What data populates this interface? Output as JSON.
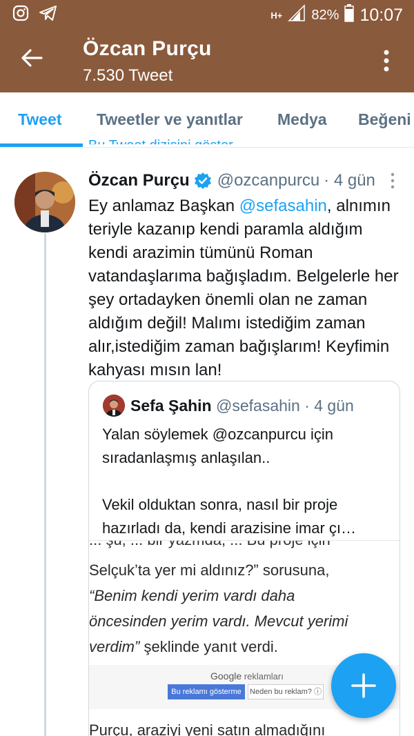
{
  "status_bar": {
    "network": "H+",
    "battery": "82%",
    "time": "10:07",
    "left_icons": [
      "instagram-icon",
      "telegram-icon"
    ]
  },
  "header": {
    "title": "Özcan Purçu",
    "subtitle": "7.530 Tweet"
  },
  "tabs": [
    {
      "label": "Tweet",
      "active": true
    },
    {
      "label": "Tweetler ve yanıtlar",
      "active": false
    },
    {
      "label": "Medya",
      "active": false
    },
    {
      "label": "Beğeni",
      "active": false
    }
  ],
  "hidden_text": "Bu Tweet dizisini göster",
  "tweet": {
    "author_name": "Özcan Purçu",
    "handle": "@ozcanpurcu",
    "time": "· 4 gün",
    "text_before_mention": "Ey anlamaz Başkan ",
    "mention": "@sefasahin",
    "text_after_mention": ", alnımın teriyle kazanıp kendi paramla aldığım kendi arazimin tümünü Roman vatandaşlarıma bağışladım. Belgelerle her şey ortadayken önemli olan ne zaman aldığım değil! Malımı istediğim zaman alır,istediğim zaman bağışlarım! Keyfimin kahyası mısın lan!"
  },
  "quoted": {
    "author_name": "Sefa Şahin",
    "handle": "@sefasahin",
    "time": "· 4 gün",
    "line1": "Yalan söylemek @ozcanpurcu için",
    "line2": "sıradanlaşmış anlaşılan..",
    "line3": "Vekil olduktan sonra, nasıl bir proje",
    "line4": "hazırladı da, kendi arazisine imar çı…",
    "image": {
      "cut_text": "... şu, ... bir yazmda, ... Bu proje için",
      "line1": "Selçuk’ta yer mi aldınız?” sorusuna,",
      "line2": "“Benim kendi yerim vardı daha",
      "line3": "öncesinden yerim vardı. Mevcut yerimi",
      "line4_italic": "verdim”",
      "line4_rest": " şeklinde yanıt verdi.",
      "ad_brand": "Google",
      "ad_label": "reklamları",
      "ad_btn1": "Bu reklamı gösterme",
      "ad_btn2": "Neden bu reklam? ⓘ",
      "bottom": "Purçu, araziyi yeni satın almadığını"
    }
  },
  "colors": {
    "app_bar": "#8a5a3c",
    "accent": "#1da1f2",
    "verified": "#1da1f2"
  }
}
